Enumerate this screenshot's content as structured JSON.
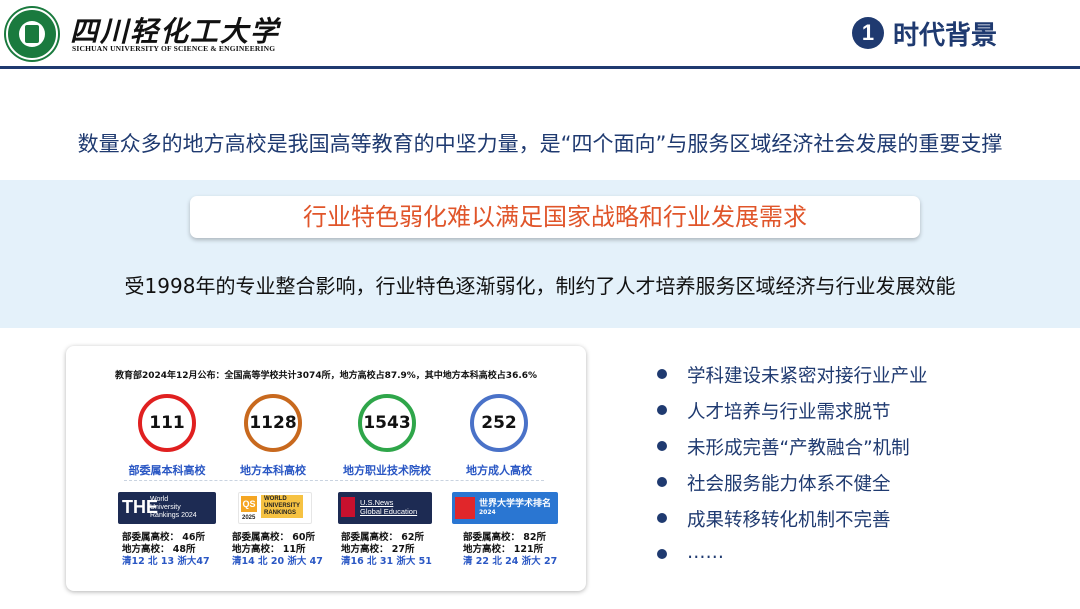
{
  "header": {
    "university_cn": "四川轻化工大学",
    "university_en": "SICHUAN UNIVERSITY OF SCIENCE & ENGINEERING",
    "section_number": "1",
    "section_title": "时代背景"
  },
  "intro": "数量众多的地方高校是我国高等教育的中坚力量，是“四个面向”与服务区域经济社会发展的重要支撑",
  "band": {
    "banner": "行业特色弱化难以满足国家战略和行业发展需求",
    "text": "受1998年的专业整合影响，行业特色逐渐弱化，制约了人才培养服务区域经济与行业发展效能"
  },
  "card": {
    "headline": "教育部2024年12月公布：全国高等学校共计3074所，地方高校占87.9%，其中地方本科高校占36.6%",
    "stats": [
      {
        "value": "111",
        "label": "部委属本科高校",
        "color": "#e02020"
      },
      {
        "value": "1128",
        "label": "地方本科高校",
        "color": "#c8691e"
      },
      {
        "value": "1543",
        "label": "地方职业技术院校",
        "color": "#2fa64a"
      },
      {
        "value": "252",
        "label": "地方成人高校",
        "color": "#4a72c8"
      }
    ],
    "rankings": [
      {
        "logo_lines": [
          "THE",
          "World",
          "University",
          "Rankings 2024"
        ],
        "line1": "部委属高校：  46所",
        "line2": "地方高校：    48所",
        "line3": "清12  北 13  浙大47"
      },
      {
        "logo_lines": [
          "QS",
          "WORLD",
          "UNIVERSITY",
          "RANKINGS",
          "2025"
        ],
        "line1": "部委属高校：  60所",
        "line2": "地方高校：    11所",
        "line3": "清14  北 20  浙大 47"
      },
      {
        "logo_lines": [
          "U.S.News",
          "Global Education"
        ],
        "line1": "部委属高校：  62所",
        "line2": "地方高校：    27所",
        "line3": "清16  北 31  浙大 51"
      },
      {
        "logo_lines": [
          "世界大学学术排名",
          "2024"
        ],
        "line1": "部委属高校：  82所",
        "line2": "地方高校：  121所",
        "line3": "清 22  北 24  浙大 27"
      }
    ]
  },
  "bullets": [
    "学科建设未紧密对接行业产业",
    "人才培养与行业需求脱节",
    "未形成完善“产教融合”机制",
    "社会服务能力体系不健全",
    "成果转移转化机制不完善",
    "……"
  ]
}
